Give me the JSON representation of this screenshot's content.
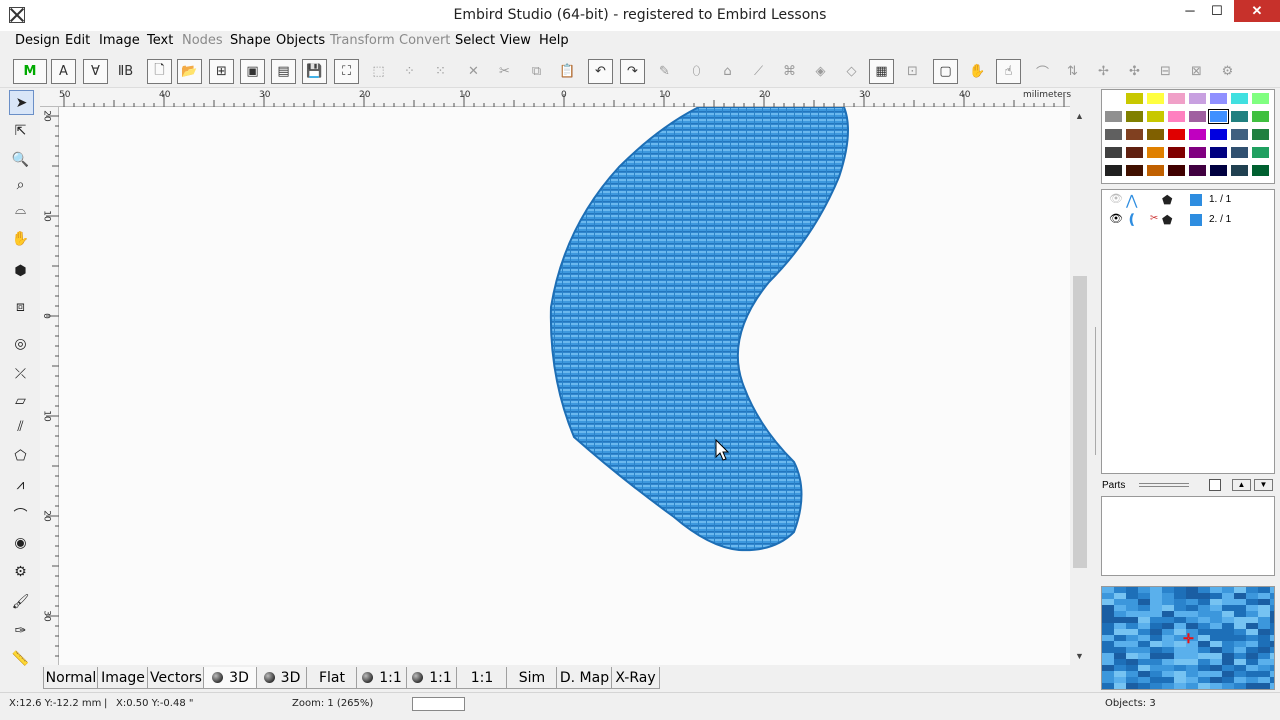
{
  "title": "Embird Studio (64-bit)  - registered to Embird Lessons",
  "window_buttons": {
    "minimize": "─",
    "maximize": "☐",
    "close": "✕"
  },
  "menu": [
    {
      "label": "Design",
      "enabled": true
    },
    {
      "label": "Edit",
      "enabled": true
    },
    {
      "label": "Image",
      "enabled": true
    },
    {
      "label": "Text",
      "enabled": true
    },
    {
      "label": "Nodes",
      "enabled": false
    },
    {
      "label": "Shape",
      "enabled": true
    },
    {
      "label": "Objects",
      "enabled": true
    },
    {
      "label": "Transform",
      "enabled": false
    },
    {
      "label": "Convert",
      "enabled": false
    },
    {
      "label": "Select",
      "enabled": true
    },
    {
      "label": "View",
      "enabled": true
    },
    {
      "label": "Help",
      "enabled": true
    }
  ],
  "ruler": {
    "unit": "milimeters",
    "top_labels": [
      "50",
      "40",
      "30",
      "20",
      "10",
      "0",
      "10",
      "20",
      "30",
      "40"
    ],
    "left_labels": [
      "20",
      "10",
      "0",
      "10",
      "20",
      "30"
    ]
  },
  "view_tabs": [
    {
      "label": "Normal"
    },
    {
      "label": "Image"
    },
    {
      "label": "Vectors"
    },
    {
      "label": "3D"
    },
    {
      "label": "3D"
    },
    {
      "label": "Flat"
    },
    {
      "label": "1:1"
    },
    {
      "label": "1:1"
    },
    {
      "label": "1:1"
    },
    {
      "label": "Sim"
    },
    {
      "label": "D. Map"
    },
    {
      "label": "X-Ray"
    }
  ],
  "status": {
    "position_mm": "X:12.6  Y:-12.2 mm",
    "position_in": "X:0.50  Y:-0.48 \"",
    "zoom": "Zoom: 1 (265%)",
    "objects": "Objects: 3"
  },
  "objects_panel": {
    "rows": [
      {
        "label": "1.  / 1"
      },
      {
        "label": "2.  / 1"
      }
    ]
  },
  "parts_label": "Parts",
  "colors": {
    "stitch_blue": "#3f97db",
    "stitch_dark": "#1e6fb5",
    "object_swatch": "#2e8de0",
    "close_red": "#c7312b"
  }
}
